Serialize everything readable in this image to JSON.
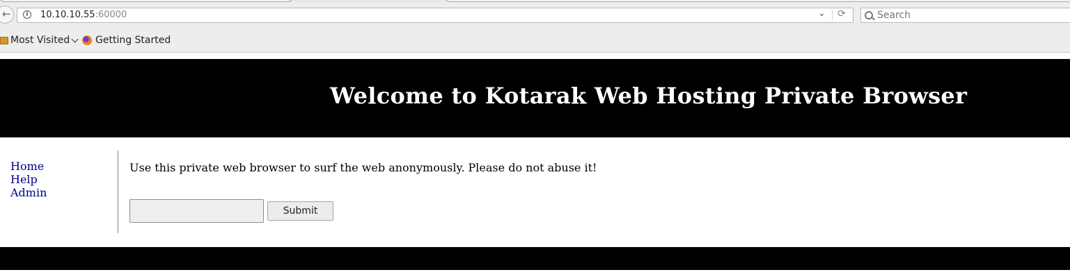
{
  "browser": {
    "url_host": "10.10.10.55",
    "url_port": ":60000",
    "search_placeholder": "Search",
    "bookmarks": [
      {
        "label": "Most Visited",
        "icon": "folder-icon"
      },
      {
        "label": "Getting Started",
        "icon": "firefox-icon"
      }
    ]
  },
  "page": {
    "header_title": "Welcome to Kotarak Web Hosting Private Browser",
    "nav": [
      "Home",
      "Help",
      "Admin"
    ],
    "intro_text": "Use this private web browser to surf the web anonymously. Please do not abuse it!",
    "url_input_value": "",
    "submit_label": "Submit"
  },
  "colors": {
    "header_bg": "#000000",
    "footer_bg": "#000000",
    "link": "#00008b",
    "chrome_bg": "#ededed"
  }
}
